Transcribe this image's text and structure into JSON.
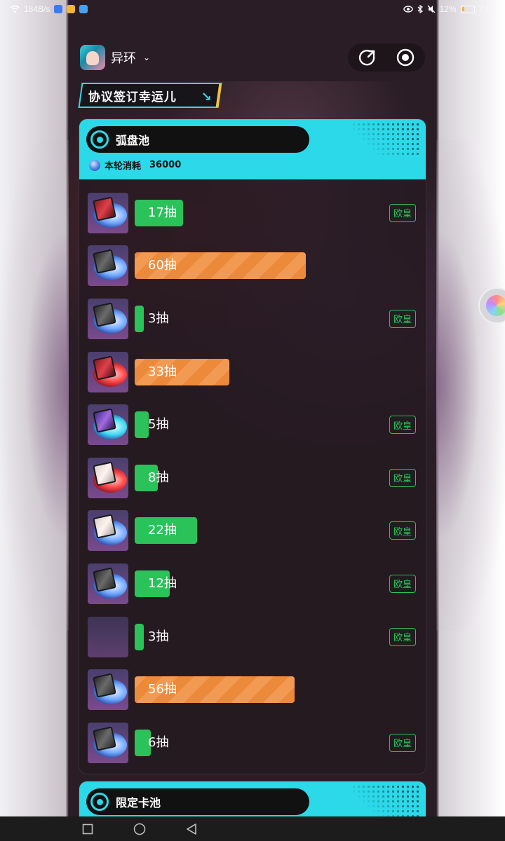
{
  "status_bar": {
    "speed": "184B/s",
    "battery_percent": "12%",
    "time": "7:01",
    "icons": [
      "wifi-icon",
      "eye-icon",
      "bluetooth-icon",
      "mute-icon",
      "battery-icon"
    ]
  },
  "header": {
    "app_name": "异环",
    "chevron": "⌄",
    "actions": [
      "share-icon",
      "record-icon"
    ]
  },
  "banner": {
    "title": "协议签订幸运儿",
    "arrow": "↘"
  },
  "pools": [
    {
      "name": "弧盘池",
      "cost_label": "本轮消耗",
      "cost_value": "36000",
      "rows": [
        {
          "draws": "17抽",
          "bar_fraction": 0.21,
          "color": "green",
          "badge": "欧皇",
          "thumb": "blue",
          "art": "red"
        },
        {
          "draws": "60抽",
          "bar_fraction": 0.74,
          "color": "orange",
          "badge": "",
          "thumb": "blue",
          "art": "dark"
        },
        {
          "draws": "3抽",
          "bar_fraction": 0.04,
          "color": "green",
          "badge": "欧皇",
          "thumb": "blue",
          "art": "dark"
        },
        {
          "draws": "33抽",
          "bar_fraction": 0.41,
          "color": "orange",
          "badge": "",
          "thumb": "red",
          "art": "red"
        },
        {
          "draws": "5抽",
          "bar_fraction": 0.06,
          "color": "green",
          "badge": "欧皇",
          "thumb": "cyan",
          "art": "purple"
        },
        {
          "draws": "8抽",
          "bar_fraction": 0.1,
          "color": "green",
          "badge": "欧皇",
          "thumb": "red",
          "art": "light"
        },
        {
          "draws": "22抽",
          "bar_fraction": 0.27,
          "color": "green",
          "badge": "欧皇",
          "thumb": "blue",
          "art": "light"
        },
        {
          "draws": "12抽",
          "bar_fraction": 0.15,
          "color": "green",
          "badge": "欧皇",
          "thumb": "blue",
          "art": "dark"
        },
        {
          "draws": "3抽",
          "bar_fraction": 0.04,
          "color": "green",
          "badge": "欧皇",
          "thumb": "empty",
          "art": ""
        },
        {
          "draws": "56抽",
          "bar_fraction": 0.69,
          "color": "orange",
          "badge": "",
          "thumb": "blue",
          "art": "dark"
        },
        {
          "draws": "6抽",
          "bar_fraction": 0.07,
          "color": "green",
          "badge": "欧皇",
          "thumb": "blue",
          "art": "dark"
        }
      ]
    },
    {
      "name": "限定卡池"
    }
  ],
  "colors": {
    "accent_cyan": "#2bd9e8",
    "green": "#2bc25a",
    "orange": "#ec8a3c",
    "background": "#2a1d25"
  },
  "nav": [
    "recent-apps-icon",
    "home-icon",
    "back-icon"
  ]
}
